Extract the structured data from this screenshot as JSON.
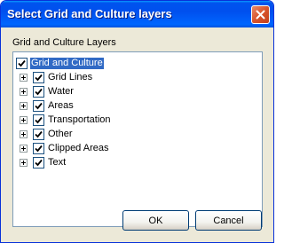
{
  "window": {
    "title": "Select Grid and Culture layers"
  },
  "group_label": "Grid and Culture Layers",
  "tree": {
    "root": {
      "label": "Grid and Culture",
      "checked": true,
      "selected": true
    },
    "children": [
      {
        "label": "Grid Lines",
        "checked": true
      },
      {
        "label": "Water",
        "checked": true
      },
      {
        "label": "Areas",
        "checked": true
      },
      {
        "label": "Transportation",
        "checked": true
      },
      {
        "label": "Other",
        "checked": true
      },
      {
        "label": "Clipped Areas",
        "checked": true
      },
      {
        "label": "Text",
        "checked": true
      }
    ]
  },
  "buttons": {
    "ok": "OK",
    "cancel": "Cancel"
  }
}
